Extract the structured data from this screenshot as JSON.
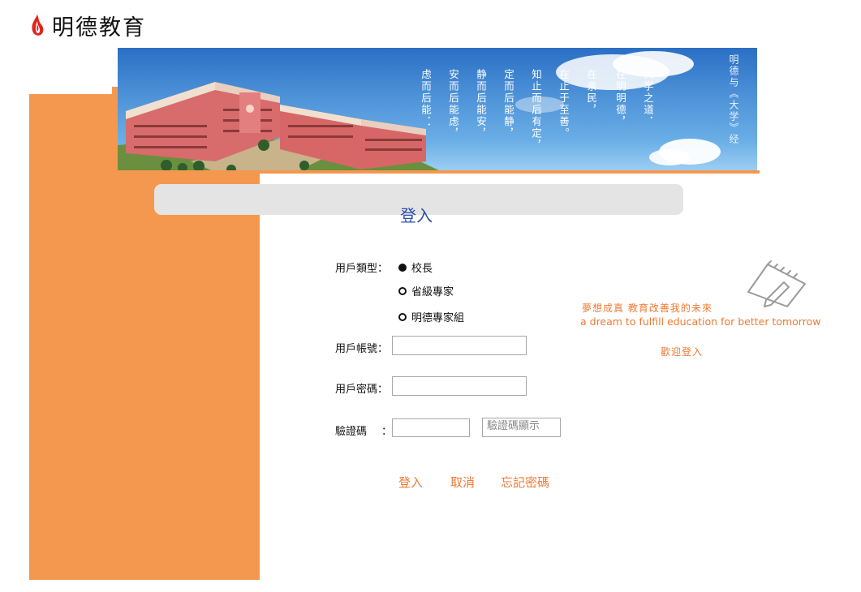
{
  "logo": {
    "text": "明德教育",
    "icon": "flame-icon"
  },
  "banner": {
    "poem_columns": [
      "大学之道．",
      "在明明德，",
      "在亲民，",
      "在止于至善。",
      "知止而后有定，",
      "定而后能静，",
      "静而后能安，",
      "安而后能虑，",
      "虑而后能．．"
    ],
    "side_text": "明德与《大学》经"
  },
  "form": {
    "title": "登入",
    "user_type_label": "用戶類型：",
    "user_types": [
      "校長",
      "省級專家",
      "明德專家組"
    ],
    "selected_user_type": "校長",
    "account_label": "用戶帳號：",
    "account_value": "",
    "password_label": "用戶密碼：",
    "password_value": "",
    "captcha_label": "驗證碼",
    "captcha_colon": "：",
    "captcha_value": "",
    "captcha_display": "驗證碼顯示"
  },
  "actions": {
    "login": "登入",
    "cancel": "取消",
    "forgot": "忘記密碼"
  },
  "slogan": {
    "cn": "夢想成真 教育改善我的未來",
    "en": "a dream to fulfill education for better tomorrow",
    "welcome": "歡迎登入"
  },
  "colors": {
    "accent": "#f5984f",
    "link": "#ef7a34",
    "title": "#2b4fa8"
  }
}
